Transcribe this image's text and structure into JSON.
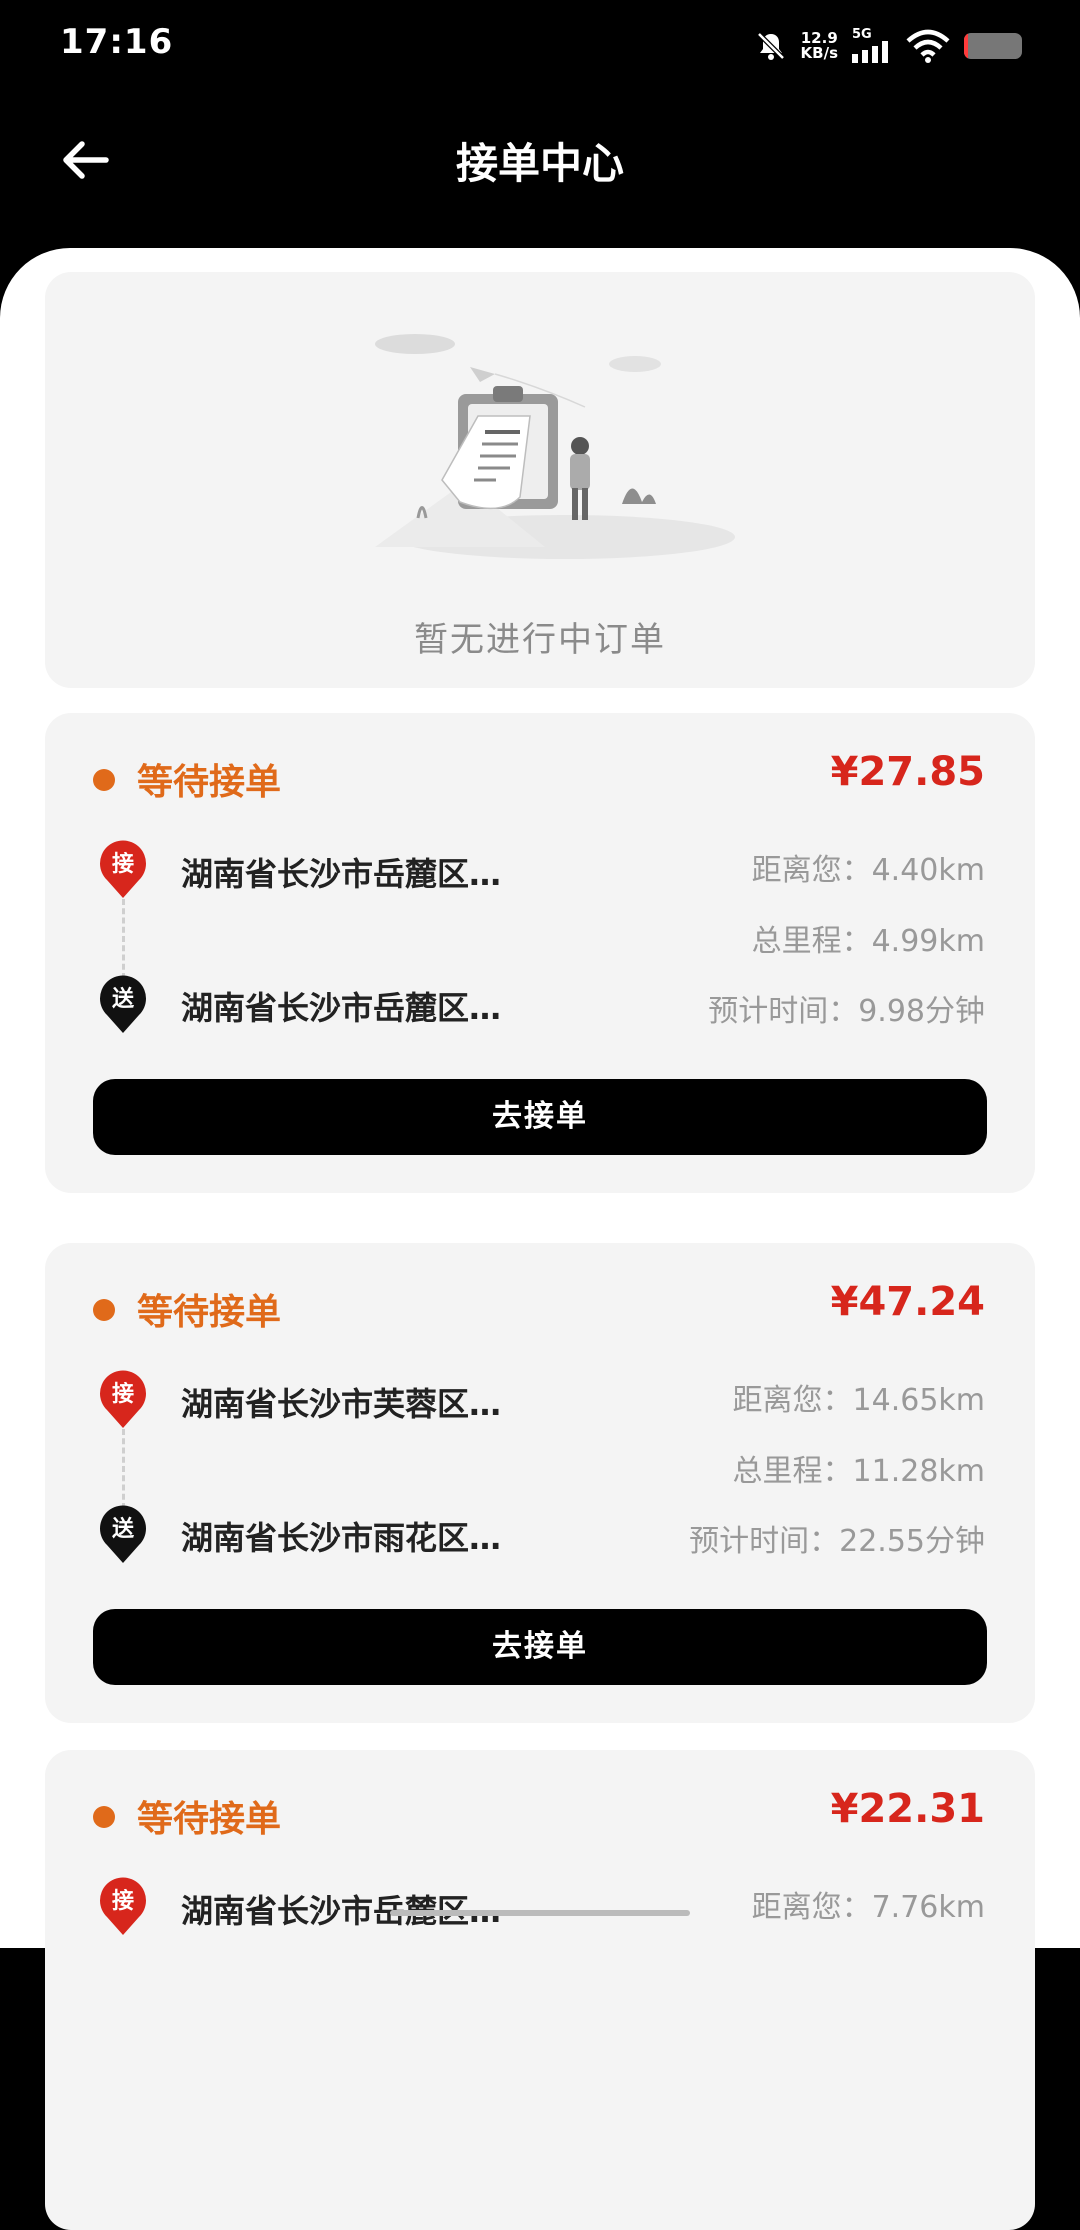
{
  "status_bar": {
    "time": "17:16",
    "speed_value": "12.9",
    "speed_unit": "KB/s",
    "network": "5G"
  },
  "header": {
    "title": "接单中心"
  },
  "empty_state": {
    "text": "暂无进行中订单"
  },
  "orders": [
    {
      "status": "等待接单",
      "price": "¥27.85",
      "pickup_tag": "接",
      "dropoff_tag": "送",
      "pickup": "湖南省长沙市岳麓区…",
      "dropoff": "湖南省长沙市岳麓区…",
      "distance_label": "距离您：",
      "distance": "4.40km",
      "total_label": "总里程：",
      "total": "4.99km",
      "eta_label": "预计时间：",
      "eta": "9.98分钟",
      "button": "去接单"
    },
    {
      "status": "等待接单",
      "price": "¥47.24",
      "pickup_tag": "接",
      "dropoff_tag": "送",
      "pickup": "湖南省长沙市芙蓉区…",
      "dropoff": "湖南省长沙市雨花区…",
      "distance_label": "距离您：",
      "distance": "14.65km",
      "total_label": "总里程：",
      "total": "11.28km",
      "eta_label": "预计时间：",
      "eta": "22.55分钟",
      "button": "去接单"
    },
    {
      "status": "等待接单",
      "price": "¥22.31",
      "pickup_tag": "接",
      "pickup": "湖南省长沙市岳麓区…",
      "distance_label": "距离您：",
      "distance": "7.76km"
    }
  ],
  "colors": {
    "status": "#e06a1a",
    "price": "#d7261c",
    "pickup_pin": "#d7261c",
    "dropoff_pin": "#111111"
  },
  "icons": {
    "back": "arrow-left-icon",
    "mute": "bell-off-icon",
    "signal": "signal-bars-icon",
    "wifi": "wifi-icon",
    "battery": "battery-icon"
  }
}
